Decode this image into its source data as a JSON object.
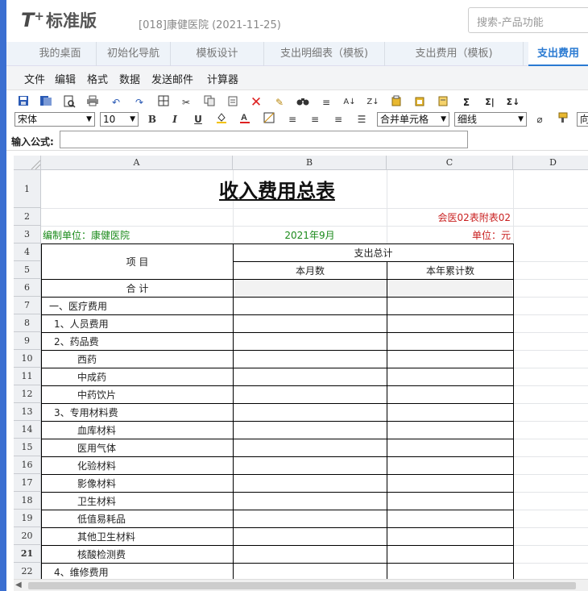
{
  "header": {
    "logo_t": "T",
    "logo_plus": "+",
    "logo_name": "标准版",
    "account": "[018]康健医院  (2021-11-25)",
    "search_placeholder": "搜索-产品功能"
  },
  "tabs": [
    "我的桌面",
    "初始化导航",
    "模板设计",
    "支出明细表（模板)",
    "支出费用（模板)",
    "支出费用"
  ],
  "menu": [
    "文件",
    "编辑",
    "格式",
    "数据",
    "发送邮件",
    "计算器"
  ],
  "toolbar": {
    "font_name": "宋体",
    "font_size": "10",
    "merge": "合并单元格",
    "border": "细线",
    "trailing": "向"
  },
  "formula_label": "输入公式:",
  "columns": [
    "A",
    "B",
    "C",
    "D"
  ],
  "rows": [
    "1",
    "2",
    "3",
    "4",
    "5",
    "6",
    "7",
    "8",
    "9",
    "10",
    "11",
    "12",
    "13",
    "14",
    "15",
    "16",
    "17",
    "18",
    "19",
    "20",
    "21",
    "22"
  ],
  "sheet": {
    "title": "收入费用总表",
    "form_code": "会医02表附表02",
    "unit_org": "编制单位：康健医院",
    "period": "2021年9月",
    "unit": "单位：元",
    "item_header": "项    目",
    "total_expense": "支出总计",
    "this_month": "本月数",
    "ytd": "本年累计数",
    "total_row": "合    计",
    "items": [
      "一、医疗费用",
      "1、人员费用",
      "2、药品费",
      "西药",
      "中成药",
      "中药饮片",
      "3、专用材料费",
      "血库材料",
      "医用气体",
      "化验材料",
      "影像材料",
      "卫生材料",
      "低值易耗品",
      "其他卫生材料",
      "核酸检测费",
      "4、维修费用"
    ]
  },
  "colors": {
    "accent": "#2a7ad2",
    "green_text": "#1a8a1a",
    "red_text": "#c81e1e"
  }
}
